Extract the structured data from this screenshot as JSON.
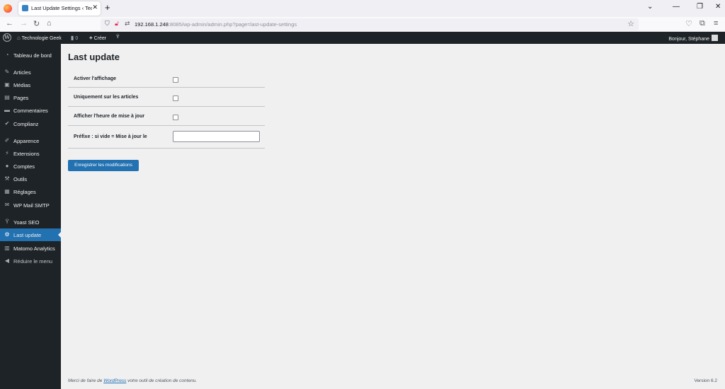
{
  "browser": {
    "tab_title": "Last Update Settings ‹ Technologie Geek",
    "tab_close": "✕",
    "new_tab": "+",
    "url_host": "192.168.1.248",
    "url_rest": ":8085/wp-admin/admin.php?page=last-update-settings",
    "window_controls": [
      "⌄",
      "—",
      "❐",
      "✕"
    ]
  },
  "adminbar": {
    "site_name": "Technologie Geek",
    "comments_count": "0",
    "new_label": "Créer",
    "greeting": "Bonjour, Stéphane"
  },
  "sidebar": {
    "items": [
      {
        "label": "Tableau de bord",
        "icon": "dashboard-icon"
      },
      {
        "label": "Articles",
        "icon": "pin-icon"
      },
      {
        "label": "Médias",
        "icon": "media-icon"
      },
      {
        "label": "Pages",
        "icon": "pages-icon"
      },
      {
        "label": "Commentaires",
        "icon": "comment-icon"
      },
      {
        "label": "Complianz",
        "icon": "check-icon"
      },
      {
        "label": "Apparence",
        "icon": "brush-icon"
      },
      {
        "label": "Extensions",
        "icon": "plugin-icon"
      },
      {
        "label": "Comptes",
        "icon": "users-icon"
      },
      {
        "label": "Outils",
        "icon": "wrench-icon"
      },
      {
        "label": "Réglages",
        "icon": "settings-icon"
      },
      {
        "label": "WP Mail SMTP",
        "icon": "mail-icon"
      },
      {
        "label": "Yoast SEO",
        "icon": "yoast-icon"
      },
      {
        "label": "Last update",
        "icon": "gear-icon"
      },
      {
        "label": "Matomo Analytics",
        "icon": "analytics-icon"
      },
      {
        "label": "Réduire le menu",
        "icon": "collapse-icon"
      }
    ],
    "active": "Last update"
  },
  "main": {
    "title": "Last update",
    "fields": [
      {
        "label": "Activer l'affichage",
        "type": "checkbox",
        "checked": false
      },
      {
        "label": "Uniquement sur les articles",
        "type": "checkbox",
        "checked": false
      },
      {
        "label": "Afficher l'heure de mise à jour",
        "type": "checkbox",
        "checked": false
      },
      {
        "label": "Préfixe : si vide = Mise à jour le",
        "type": "text",
        "value": ""
      }
    ],
    "save_label": "Enregistrer les modifications"
  },
  "footer": {
    "prefix": "Merci de faire de ",
    "link": "WordPress",
    "suffix": " votre outil de création de contenu.",
    "version": "Version 6.2"
  },
  "colors": {
    "accent": "#2271b1",
    "admin_bg": "#1d2327",
    "page_bg": "#f0f0f1"
  }
}
